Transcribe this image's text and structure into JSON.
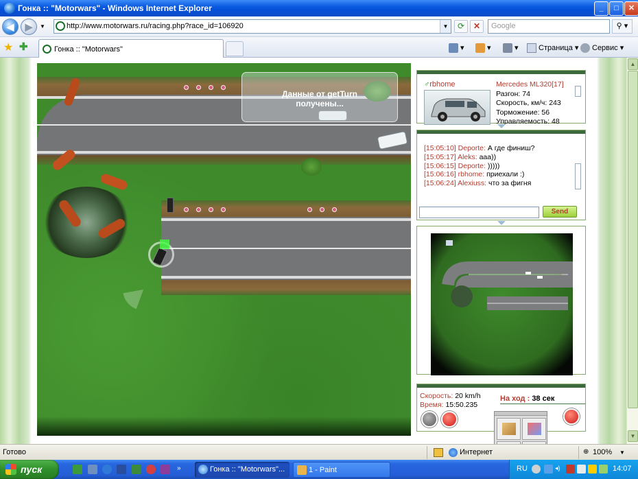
{
  "window": {
    "title": "Гонка :: \"Motorwars\" - Windows Internet Explorer",
    "controls": {
      "minimize": "_",
      "maximize": "□",
      "close": "✕"
    }
  },
  "addressbar": {
    "url": "http://www.motorwars.ru/racing.php?race_id=106920",
    "search_placeholder": "Google"
  },
  "tabs": {
    "active_label": "Гонка :: \"Motorwars\"",
    "commands": {
      "page": "Страница",
      "tools": "Сервис"
    }
  },
  "game": {
    "overlay_text": "Данные от getTurn получены..."
  },
  "car_panel": {
    "player": "rbhome",
    "model": "Mercedes ML320[17]",
    "stats": [
      "Разгон: 74",
      "Скорость, км/ч: 243",
      "Торможение: 56",
      "Управляемость: 48"
    ]
  },
  "chat": {
    "messages": [
      {
        "time": "[15:05:10]",
        "name": "Deporte:",
        "text": "А где финиш?"
      },
      {
        "time": "[15:05:17]",
        "name": "Aleks:",
        "text": "aaa))"
      },
      {
        "time": "[15:06:15]",
        "name": "Deporte:",
        "text": ")))))"
      },
      {
        "time": "[15:06:16]",
        "name": "rbhome:",
        "text": "приехали :)"
      },
      {
        "time": "[15:06:24]",
        "name": "Alexiuss:",
        "text": "что за фигня"
      }
    ],
    "input_value": "",
    "send_label": "Send"
  },
  "status_panel": {
    "speed_label": "Скорость:",
    "speed_value": "20 km/h",
    "time_label": "Время:",
    "time_value": "15:50.235",
    "turn_label": "На ход :",
    "turn_value": "38 сек"
  },
  "statusbar": {
    "left": "Готово",
    "zone": "Интернет",
    "zoom": "100%"
  },
  "taskbar": {
    "start_label": "пуск",
    "buttons": [
      {
        "label": "Гонка :: \"Motorwars\"..."
      },
      {
        "label": "1 - Paint"
      }
    ],
    "lang": "RU",
    "clock": "14:07"
  },
  "colors": {
    "accent_red": "#b43c2e",
    "panel_header": "#3d6a3d",
    "xp_blue": "#245ed6",
    "grass": "#3f8b2c"
  }
}
